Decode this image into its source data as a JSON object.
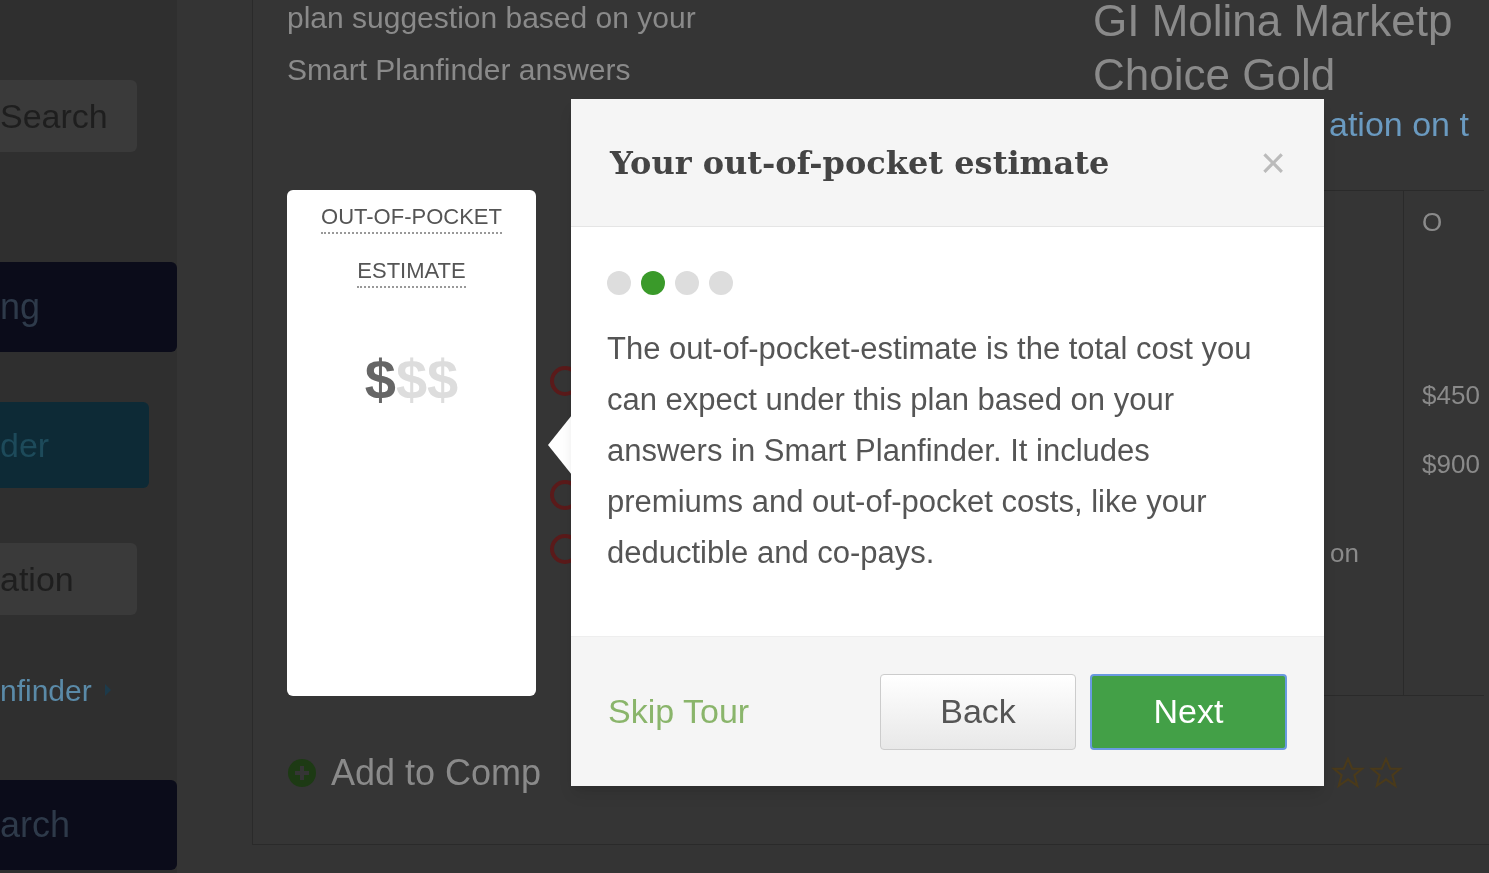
{
  "sidebar": {
    "items": [
      {
        "label": "Search",
        "kind": "plain"
      },
      {
        "label": "ng",
        "kind": "navy"
      },
      {
        "label": "der",
        "kind": "teal"
      },
      {
        "label": "ation",
        "kind": "plain"
      },
      {
        "label": "nfinder",
        "kind": "link"
      },
      {
        "label": "arch",
        "kind": "navy"
      }
    ]
  },
  "plan": {
    "intro": [
      "plan suggestion based on your",
      "Smart Planfinder answers"
    ],
    "title": [
      "GI Molina Marketp",
      "Choice Gold"
    ],
    "link": "ation on t",
    "highlight_card": {
      "title": [
        "OUT-OF-POCKET",
        "ESTIMATE"
      ],
      "cost_signs": [
        {
          "text": "$",
          "filled": true
        },
        {
          "text": "$",
          "filled": false
        },
        {
          "text": "$",
          "filled": false
        }
      ]
    },
    "table": {
      "header": "O",
      "values": [
        "$450",
        "$900"
      ],
      "side_text": "on"
    },
    "add_to_compare": "Add to Comp"
  },
  "tour": {
    "title": "Your out-of-pocket estimate",
    "close": "×",
    "steps": [
      {
        "selected": false
      },
      {
        "selected": true
      },
      {
        "selected": false
      },
      {
        "selected": false
      }
    ],
    "body": "The out-of-pocket-estimate is the total cost you can expect under this plan based on your answers in Smart Planfinder. It includes premiums and out-of-pocket costs, like your deductible and co-pays.",
    "skip": "Skip Tour",
    "back": "Back",
    "next": "Next"
  }
}
